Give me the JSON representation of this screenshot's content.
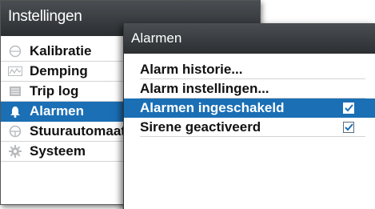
{
  "settings": {
    "title": "Instellingen",
    "items": [
      {
        "label": "Kalibratie",
        "icon": "calibration-icon"
      },
      {
        "label": "Demping",
        "icon": "damping-icon"
      },
      {
        "label": "Trip log",
        "icon": "trip-log-icon"
      },
      {
        "label": "Alarmen",
        "icon": "alarm-bell-icon",
        "selected": true
      },
      {
        "label": "Stuurautomaat",
        "icon": "steering-wheel-icon"
      },
      {
        "label": "Systeem",
        "icon": "gear-icon"
      }
    ]
  },
  "alarms": {
    "title": "Alarmen",
    "items": [
      {
        "label": "Alarm historie..."
      },
      {
        "label": "Alarm instellingen..."
      },
      {
        "label": "Alarmen ingeschakeld",
        "checked": true,
        "selected": true
      },
      {
        "label": "Sirene geactiveerd",
        "checked": true
      }
    ]
  },
  "colors": {
    "selection": "#1a6fb5",
    "titlebar": "#3a3d40"
  }
}
